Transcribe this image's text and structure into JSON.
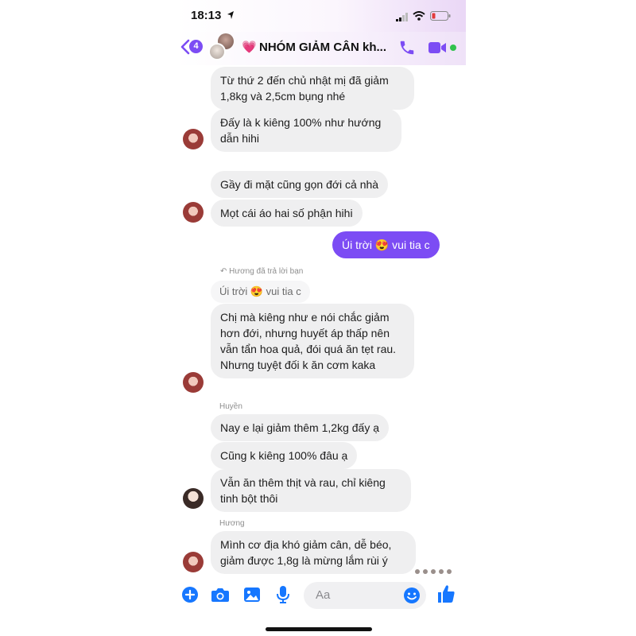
{
  "status": {
    "time": "18:13"
  },
  "header": {
    "back_count": "4",
    "emoji": "💗",
    "title": "NHÓM GIẢM CÂN kh..."
  },
  "messages": [
    {
      "text": "Từ thứ 2 đến chủ nhật mị đã giảm 1,8kg và 2,5cm bụng nhé"
    },
    {
      "text": "Đấy là k kiêng 100% như hướng dẫn hihi"
    },
    {
      "text": "Gầy đi mặt cũng gọn đới cả nhà"
    },
    {
      "text": "Mọt cái áo hai số phận hihi"
    },
    {
      "text": "Úi trời 😍 vui tia c"
    },
    {
      "text": "Hương đã trả lời bạn"
    },
    {
      "text": "Úi trời 😍 vui tia c"
    },
    {
      "text": "Chị mà kiêng như e nói chắc giảm hơn đới, nhưng huyết áp thấp nên vẫn tẩn hoa quả, đói quá ăn tẹt rau. Nhưng tuyệt đối k ăn cơm kaka"
    },
    {
      "text": "Huyền"
    },
    {
      "text": "Nay e lại giảm thêm 1,2kg đấy ạ"
    },
    {
      "text": "Cũng k kiêng 100% đâu ạ"
    },
    {
      "text": "Vẫn ăn thêm thịt và rau, chỉ kiêng tinh bột thôi"
    },
    {
      "text": "Hương"
    },
    {
      "text": "Mình cơ địa khó giảm cân, dễ béo, giảm được 1,8g là mừng lắm rùi ý"
    }
  ],
  "composer": {
    "placeholder": "Aa"
  },
  "colors": {
    "accent": "#7c4cf4",
    "bubble_in": "#efeff0",
    "online": "#31c24d"
  },
  "icons": [
    "back-arrow-icon",
    "phone-icon",
    "video-icon",
    "plus-circle-icon",
    "camera-icon",
    "image-icon",
    "microphone-icon",
    "emoji-icon",
    "thumbs-up-icon",
    "location-arrow-icon",
    "signal-icon",
    "wifi-icon",
    "battery-icon",
    "reply-arrow-icon"
  ]
}
